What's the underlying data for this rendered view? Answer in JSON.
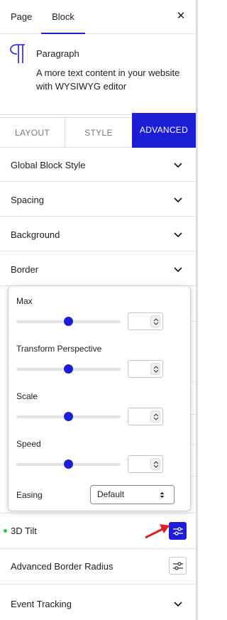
{
  "top_tabs": {
    "page": "Page",
    "block": "Block",
    "close": "✕"
  },
  "block": {
    "title": "Paragraph",
    "description": "A more text content in your website with WYSIWYG editor"
  },
  "section_tabs": {
    "layout": "LAYOUT",
    "style": "STYLE",
    "advanced": "ADVANCED",
    "active": "ADVANCED"
  },
  "panels": [
    {
      "label": "Global Block Style"
    },
    {
      "label": "Spacing"
    },
    {
      "label": "Background"
    },
    {
      "label": "Border"
    }
  ],
  "popup": {
    "sliders": [
      {
        "label": "Max",
        "value": "",
        "level": 0.5
      },
      {
        "label": "Transform Perspective",
        "value": "",
        "level": 0.5
      },
      {
        "label": "Scale",
        "value": "",
        "level": 0.5
      },
      {
        "label": "Speed",
        "value": "",
        "level": 0.5
      }
    ],
    "easing": {
      "label": "Easing",
      "selected": "Default"
    }
  },
  "bottom_rows": {
    "tilt": {
      "label": "3D Tilt",
      "active": true
    },
    "radius": {
      "label": "Advanced Border Radius"
    },
    "event": {
      "label": "Event Tracking"
    }
  },
  "colors": {
    "accent": "#1d1dd6",
    "active_dot": "#2fbf4f",
    "arrow": "#e02020"
  }
}
